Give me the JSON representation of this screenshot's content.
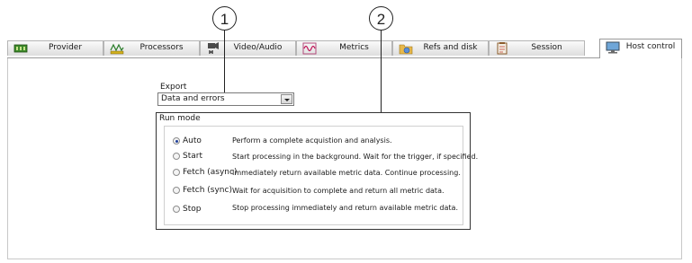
{
  "callouts": {
    "one": "1",
    "two": "2"
  },
  "tabs": [
    {
      "label": "Provider",
      "icon": "provider-icon"
    },
    {
      "label": "Processors",
      "icon": "processors-icon"
    },
    {
      "label": "Video/Audio",
      "icon": "video-audio-icon"
    },
    {
      "label": "Metrics",
      "icon": "metrics-icon"
    },
    {
      "label": "Refs and disk",
      "icon": "refs-disk-icon"
    },
    {
      "label": "Session",
      "icon": "session-icon"
    },
    {
      "label": "Host control",
      "icon": "host-control-icon",
      "active": true
    }
  ],
  "export": {
    "label": "Export",
    "selected": "Data and errors"
  },
  "run_mode": {
    "title": "Run mode",
    "options": [
      {
        "label": "Auto",
        "description": "Perform a complete acquistion and analysis.",
        "checked": true
      },
      {
        "label": "Start",
        "description": "Start processing in the background. Wait for the trigger, if specified."
      },
      {
        "label": "Fetch (async)",
        "description": "Immediately return available metric data. Continue processing."
      },
      {
        "label": "Fetch (sync)",
        "description": "Wait for acquisition to complete and return all metric data."
      },
      {
        "label": "Stop",
        "description": "Stop processing immediately and return available metric data."
      }
    ]
  }
}
